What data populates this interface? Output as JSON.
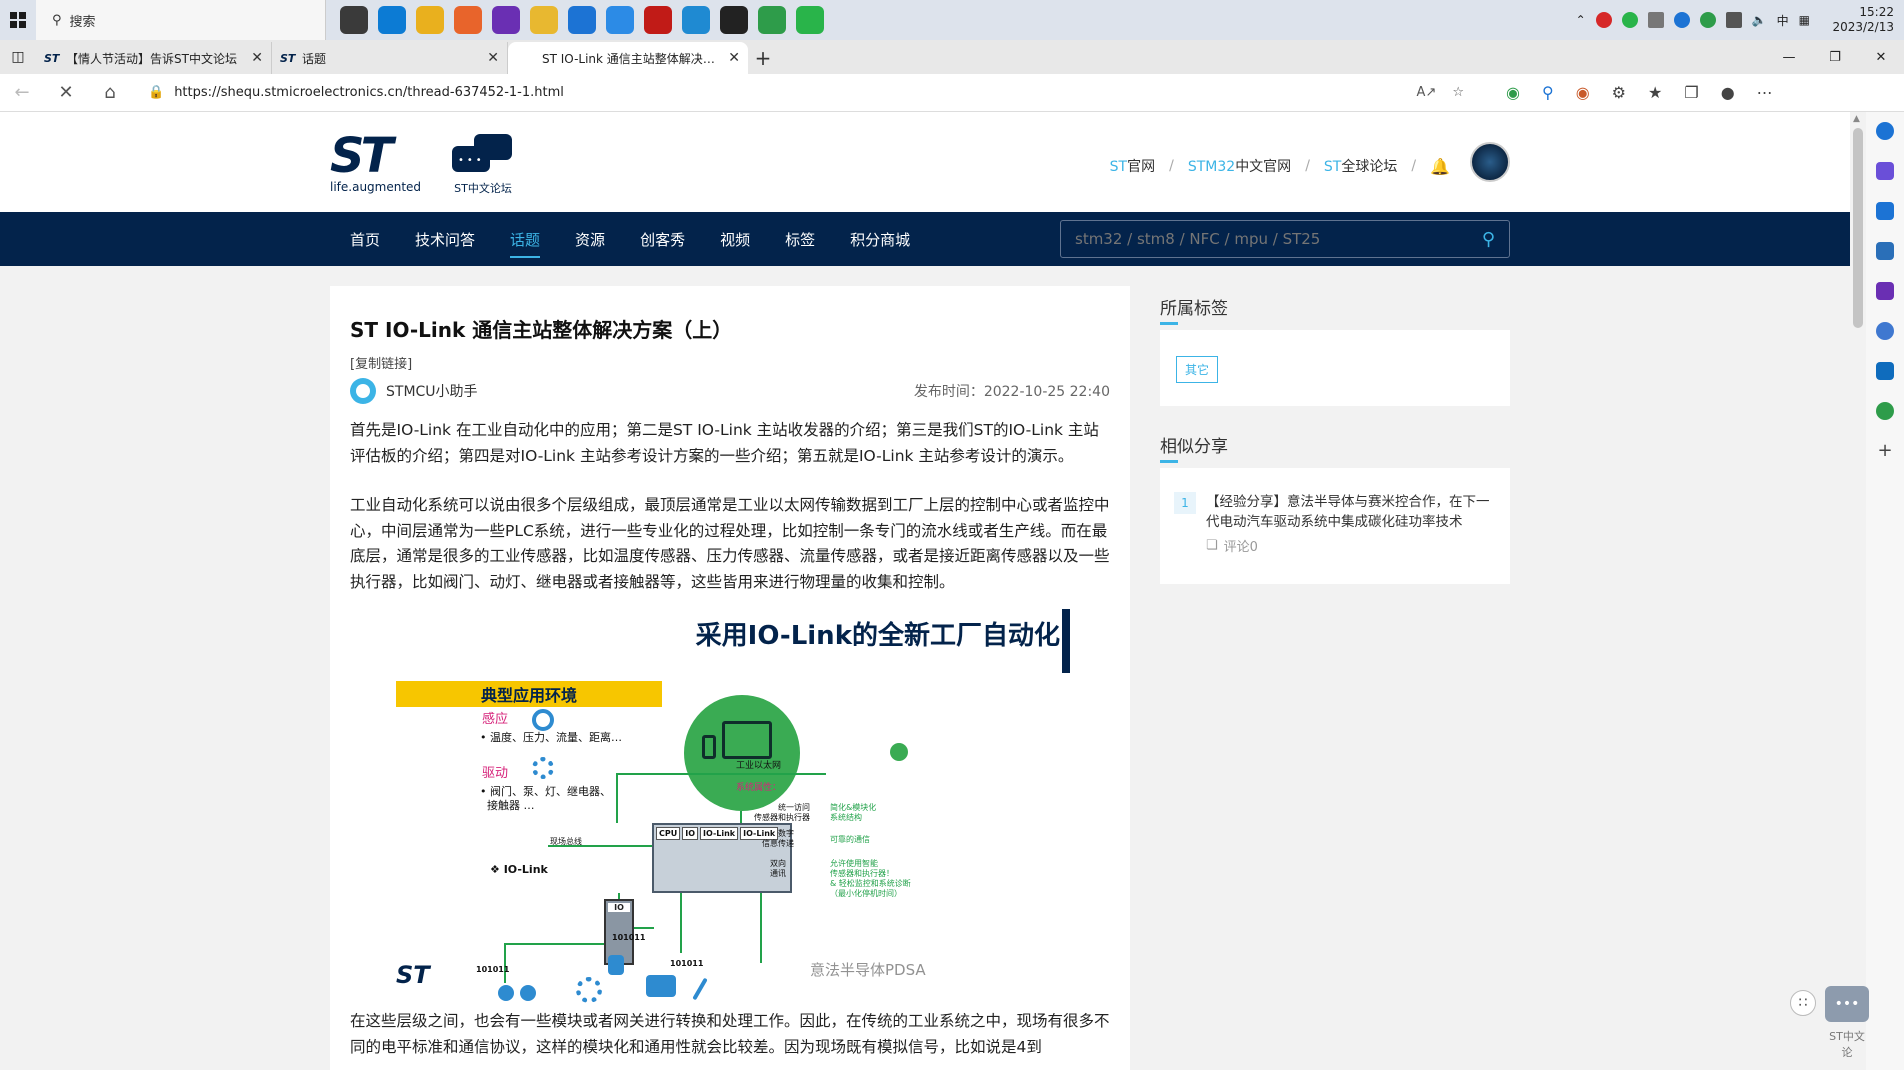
{
  "taskbar": {
    "search_placeholder": "搜索",
    "clock_time": "15:22",
    "clock_date": "2023/2/13",
    "ime": "中",
    "apps": [
      {
        "name": "task-view",
        "color": "#3a3a3a"
      },
      {
        "name": "edge",
        "color": "#0c7bd4"
      },
      {
        "name": "chrome",
        "color": "#e9b01e"
      },
      {
        "name": "firefox",
        "color": "#e8642b"
      },
      {
        "name": "podcast",
        "color": "#6a2fb3"
      },
      {
        "name": "files",
        "color": "#e8b830"
      },
      {
        "name": "mail",
        "color": "#1c73d4"
      },
      {
        "name": "app-blue",
        "color": "#2c8be6"
      },
      {
        "name": "acrobat",
        "color": "#c11b17"
      },
      {
        "name": "vscode",
        "color": "#1f8ad2"
      },
      {
        "name": "app-dark",
        "color": "#222222"
      },
      {
        "name": "app-green",
        "color": "#2e9c4a"
      },
      {
        "name": "wechat",
        "color": "#29b44a"
      }
    ]
  },
  "tabs": [
    {
      "title": "【情人节活动】告诉ST中文论坛",
      "active": false
    },
    {
      "title": "话题",
      "active": false
    },
    {
      "title": "ST IO-Link 通信主站整体解决方案",
      "active": true
    }
  ],
  "address": {
    "url": "https://shequ.stmicroelectronics.cn/thread-637452-1-1.html"
  },
  "header": {
    "logo_tagline": "life.augmented",
    "forum_label": "ST中文论坛",
    "links": [
      {
        "brand": "ST",
        "rest": "官网"
      },
      {
        "brand": "STM32",
        "rest": "中文官网"
      },
      {
        "brand": "ST",
        "rest": "全球论坛"
      }
    ]
  },
  "nav": {
    "items": [
      "首页",
      "技术问答",
      "话题",
      "资源",
      "创客秀",
      "视频",
      "标签",
      "积分商城"
    ],
    "active_index": 2,
    "search_placeholder": "stm32 / stm8 / NFC / mpu / ST25"
  },
  "article": {
    "title": "ST IO-Link 通信主站整体解决方案（上）",
    "copy_link": "[复制链接]",
    "author": "STMCU小助手",
    "published": "发布时间：2022-10-25 22:40",
    "para1": "首先是IO-Link 在工业自动化中的应用；第二是ST IO-Link 主站收发器的介绍；第三是我们ST的IO-Link 主站评估板的介绍；第四是对IO-Link 主站参考设计方案的一些介绍；第五就是IO-Link 主站参考设计的演示。",
    "para2": "工业自动化系统可以说由很多个层级组成，最顶层通常是工业以太网传输数据到工厂上层的控制中心或者监控中心，中间层通常为一些PLC系统，进行一些专业化的过程处理，比如控制一条专门的流水线或者生产线。而在最底层，通常是很多的工业传感器，比如温度传感器、压力传感器、流量传感器，或者是接近距离传感器以及一些执行器，比如阀门、动灯、继电器或者接触器等，这些皆用来进行物理量的收集和控制。",
    "para3": "在这些层级之间，也会有一些模块或者网关进行转换和处理工作。因此，在传统的工业系统之中，现场有很多不同的电平标准和通信协议，这样的模块化和通用性就会比较差。因为现场既有模拟信号，比如说是4到"
  },
  "figure": {
    "title": "采用IO-Link的全新工厂自动化",
    "banner": "典型应用环境",
    "sense_label": "感应",
    "sense_items": "• 温度、压力、流量、距离…",
    "drive_label": "驱动",
    "drive_items": "• 阀门、泵、灯、继电器、\n  接触器 …",
    "ethernet": "工业以太网",
    "fieldbus": "现场总线",
    "iolink_logo": "IO-Link",
    "plc_cells": [
      "CPU",
      "IO",
      "IO-Link",
      "IO-Link"
    ],
    "io_label": "IO",
    "bits": [
      "101011",
      "101011",
      "101011"
    ],
    "sys_attr": "系统属性：",
    "row1_left": "统一访问\n传感器和执行器",
    "row1_right": "简化&模块化\n系统结构",
    "row2_left": "数字\n信息传递",
    "row2_right": "可靠的通信",
    "row3_left": "双向\n通讯",
    "row3_right": "允许使用智能\n传感器和执行器！\n& 轻松监控和系统诊断\n（最小化停机时间）",
    "watermark": "意法半导体PDSA",
    "st_tag": "life.augmented"
  },
  "sidebar": {
    "tags_title": "所属标签",
    "tag": "其它",
    "similar_title": "相似分享",
    "similar": [
      {
        "num": "1",
        "text": "【经验分享】意法半导体与赛米控合作，在下一代电动汽车驱动系统中集成碳化硅功率技术",
        "comments": "评论0"
      }
    ]
  },
  "float": {
    "chat_label": "ST中文论"
  }
}
